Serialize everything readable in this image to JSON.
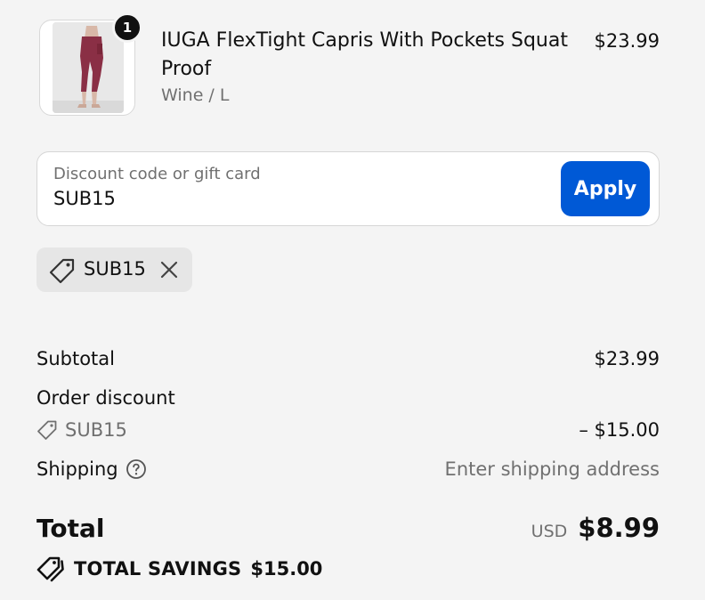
{
  "product": {
    "quantity": "1",
    "name": "IUGA FlexTight Capris With Pockets Squat Proof",
    "variant": "Wine / L",
    "price": "$23.99",
    "image_colors": {
      "garment": "#8a2f45",
      "background": "#e6e6e6"
    }
  },
  "discount": {
    "placeholder": "Discount code or gift card",
    "value": "SUB15",
    "apply_label": "Apply",
    "applied_code": "SUB15",
    "remove_icon": "close-icon"
  },
  "summary": {
    "subtotal_label": "Subtotal",
    "subtotal_value": "$23.99",
    "order_discount_label": "Order discount",
    "order_discount_code": "SUB15",
    "order_discount_value": "– $15.00",
    "shipping_label": "Shipping",
    "shipping_value": "Enter shipping address",
    "total_label": "Total",
    "total_currency": "USD",
    "total_value": "$8.99",
    "savings_label": "TOTAL SAVINGS",
    "savings_value": "$15.00"
  },
  "colors": {
    "accent": "#0059d6",
    "background": "#f4f4f4",
    "muted_text": "#707070",
    "chip_background": "#e6e6e6"
  }
}
